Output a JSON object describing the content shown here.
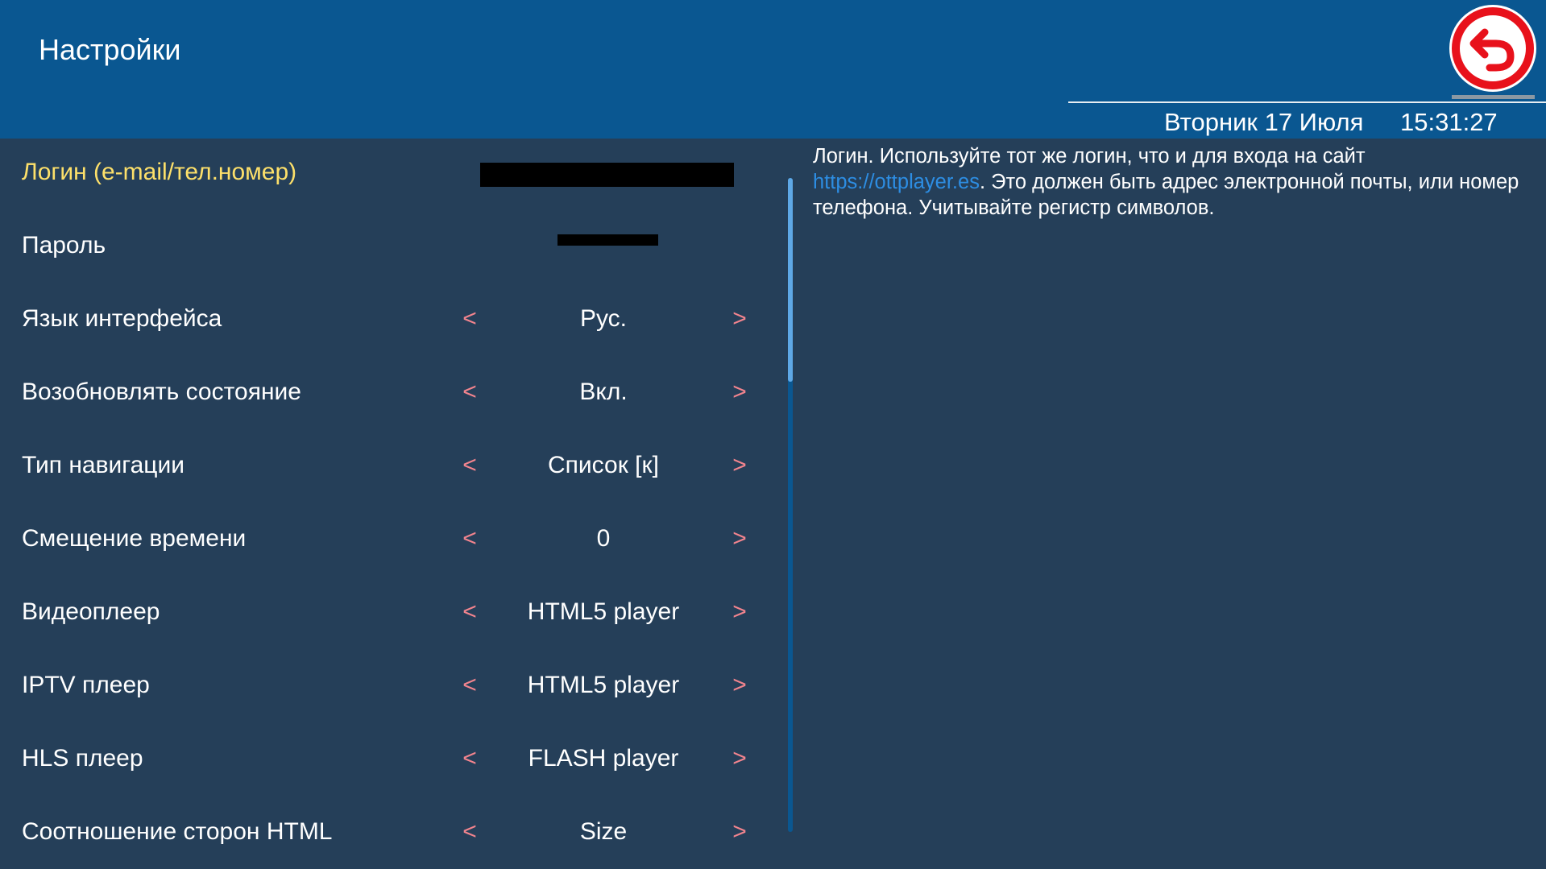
{
  "header": {
    "title": "Настройки",
    "date": "Вторник 17 Июля",
    "time": "15:31:27",
    "back_icon": "back-arrow-icon",
    "back_color": "#e8111b"
  },
  "settings": {
    "login": {
      "label": "Логин (e-mail/тел.номер)"
    },
    "password": {
      "label": "Пароль"
    },
    "rows": [
      {
        "label": "Язык интерфейса",
        "value": "Рус.",
        "prev": "<",
        "next": ">"
      },
      {
        "label": "Возобновлять состояние",
        "value": "Вкл.",
        "prev": "<",
        "next": ">"
      },
      {
        "label": "Тип навигации",
        "value": "Список [к]",
        "prev": "<",
        "next": ">"
      },
      {
        "label": "Смещение времени",
        "value": "0",
        "prev": "<",
        "next": ">"
      },
      {
        "label": "Видеоплеер",
        "value": "HTML5 player",
        "prev": "<",
        "next": ">"
      },
      {
        "label": "IPTV плеер",
        "value": "HTML5 player",
        "prev": "<",
        "next": ">"
      },
      {
        "label": "HLS плеер",
        "value": "FLASH player",
        "prev": "<",
        "next": ">"
      },
      {
        "label": "Соотношение сторон HTML",
        "value": "Size",
        "prev": "<",
        "next": ">"
      }
    ]
  },
  "help": {
    "text_before": "Логин. Используйте тот же логин, что и для входа на сайт ",
    "link": "https://ottplayer.es",
    "text_after": ". Это должен быть адрес электронной почты, или номер телефона. Учитывайте регистр символов."
  },
  "colors": {
    "header_bg": "#0a5791",
    "body_bg": "#253f59",
    "selected_label": "#fde06a",
    "arrow": "#f2848e",
    "link": "#2d8de2"
  }
}
